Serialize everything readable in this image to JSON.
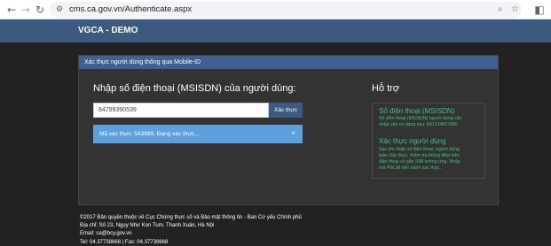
{
  "browser": {
    "url": "cms.ca.gov.vn/Authenticate.aspx"
  },
  "site": {
    "brand": "VGCA - DEMO"
  },
  "panel": {
    "heading": "Xác thực người dùng thông qua Mobile-ID"
  },
  "form": {
    "title": "Nhập số điện thoại (MSISDN) của người dùng:",
    "phone_value": "84799390539",
    "verify_label": "Xác thực",
    "alert_text": "Mã xác thực: 543989. Đang xác thực...",
    "alert_close": "×"
  },
  "help": {
    "title": "Hỗ trợ",
    "items": [
      {
        "heading": "Số điện thoại (MSISDN)",
        "lines": [
          "Số điện thoại (MSISDN) người dùng cần",
          "nhập vào có dạng sau: 841234567890"
        ]
      },
      {
        "heading": "Xác thực người dùng",
        "lines": [
          "Sau khi nhập số điện thoại, người dùng",
          "bấm Xác thực. Kiểm tra thông điệp trên",
          "điện thoại có gắn SIM tương ứng. Nhập",
          "mã PIN để tiến hành xác thực."
        ]
      }
    ]
  },
  "footer": {
    "lines": [
      "©2017 Bản quyền thuộc về Cục Chứng thực số và Bảo mật thông tin - Ban Cơ yếu Chính phủ",
      "Địa chỉ: Số 23, Ngụy Như Kon Tum, Thanh Xuân, Hà Nội",
      "Email: ca@bcy.gov.vn",
      "Tel: 04.37738668 | Fax: 04.37738668"
    ]
  },
  "colors": {
    "header": "#3c5a80",
    "panel_head": "#3f6090",
    "alert": "#5ea0dd",
    "help_text": "#3cc47c"
  },
  "icons": [
    "back-arrow-icon",
    "forward-arrow-icon",
    "reload-icon",
    "site-info-icon",
    "zoom-icon",
    "star-icon",
    "side-panel-icon",
    "close-icon"
  ]
}
